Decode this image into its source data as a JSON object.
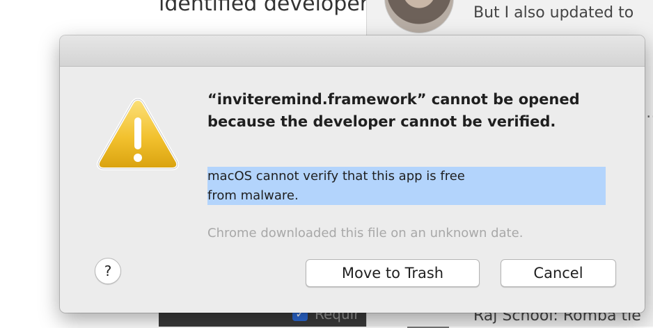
{
  "background": {
    "heading": "identified developer",
    "message_preview": "But I also updated to",
    "ellipsis": "…",
    "require_label": "Requir",
    "footer_text": "Raj School: Romba tie"
  },
  "dialog": {
    "title": "“inviteremind.framework” cannot be opened because the developer cannot be verified.",
    "message_lines": [
      "macOS cannot verify that this app is free",
      "from malware."
    ],
    "info": "Chrome downloaded this file on an unknown date.",
    "help_label": "?",
    "buttons": {
      "move_to_trash": "Move to Trash",
      "cancel": "Cancel"
    },
    "icon": "warning-triangle-icon",
    "colors": {
      "selection": "#b3d4fc",
      "warning_fill": "#f2c12e"
    }
  }
}
